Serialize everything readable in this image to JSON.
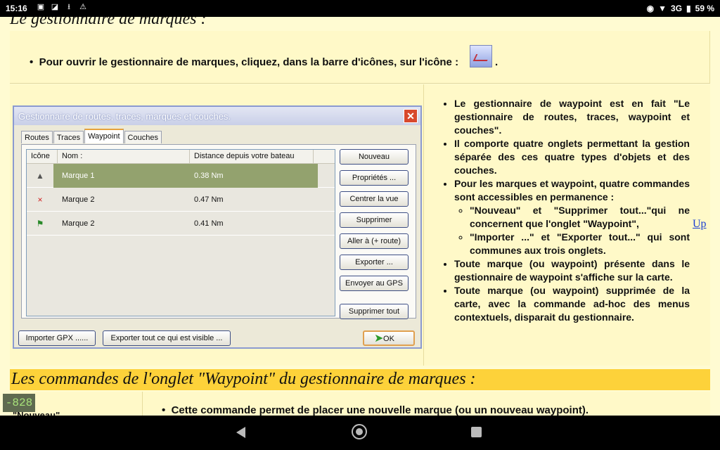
{
  "status": {
    "time": "15:16",
    "network": "3G",
    "battery": "59 %"
  },
  "page": {
    "heading1": "Le gestionnaire de marques :",
    "open_instruction": "Pour ouvrir le gestionnaire de marques, cliquez, dans la barre d'icônes, sur l'icône :",
    "open_instruction_end": ".",
    "heading2": "Les commandes de l'onglet \"Waypoint\" du gestionnaire de marques :",
    "row3_left_cut": "\"Nouveau\"",
    "row3_bullet": "Cette commande permet de placer une nouvelle marque (ou un nouveau waypoint).",
    "up_link": "Up",
    "counter": "-828"
  },
  "dialog": {
    "title": "Gestionnaire de routes, traces, marques et couches.",
    "close": "✕",
    "tabs": [
      "Routes",
      "Traces",
      "Waypoint",
      "Couches"
    ],
    "columns": [
      "Icône",
      "Nom :",
      "Distance depuis votre bateau"
    ],
    "rows": [
      {
        "icon": "▲",
        "name": "Marque 1",
        "distance": "0.38 Nm"
      },
      {
        "icon": "×",
        "name": "Marque 2",
        "distance": "0.47 Nm"
      },
      {
        "icon": "⚑",
        "name": "Marque 2",
        "distance": "0.41 Nm"
      }
    ],
    "buttons": [
      "Nouveau",
      "Propriétés ...",
      "Centrer la vue",
      "Supprimer",
      "Aller à (+ route)",
      "Exporter ...",
      "Envoyer au GPS",
      "Supprimer tout"
    ],
    "import_btn": "Importer GPX ......",
    "export_btn": "Exporter tout ce qui est visible ...",
    "ok_btn": "OK"
  },
  "right_text": {
    "b1": "Le gestionnaire de waypoint est en fait \"Le gestionnaire de routes, traces, waypoint et couches\".",
    "b2": "Il comporte quatre onglets permettant la gestion séparée des ces quatre types d'objets et des couches.",
    "b3": "Pour les marques et waypoint, quatre commandes sont accessibles en permanence :",
    "b3a": "\"Nouveau\" et \"Supprimer tout...\"qui ne concernent que l'onglet \"Waypoint\",",
    "b3b": "\"Importer ...\" et \"Exporter tout...\" qui sont communes aux trois onglets.",
    "b4": "Toute marque (ou waypoint) présente dans le gestionnaire de waypoint s'affiche sur la carte.",
    "b5": "Toute marque (ou waypoint) supprimée de la carte, avec la commande ad-hoc des menus contextuels, disparait du gestionnaire."
  }
}
